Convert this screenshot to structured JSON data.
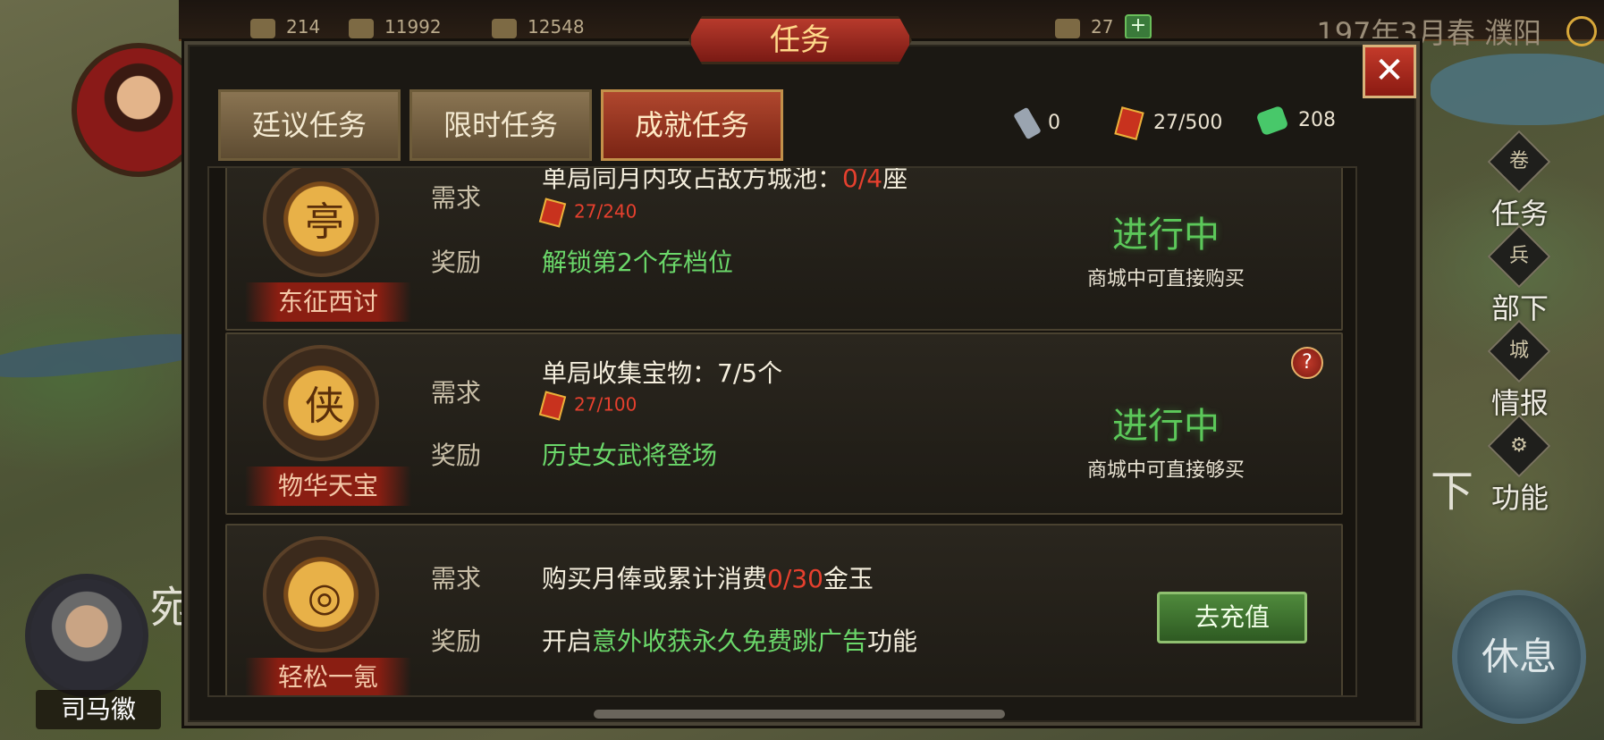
{
  "topbar": {
    "resources": [
      "214",
      "11992",
      "12548",
      "27"
    ],
    "date_location": "197年3月春 濮阳"
  },
  "left": {
    "character_name": "司马徽",
    "map_text": "宛"
  },
  "right_menu": {
    "items": [
      {
        "label": "任务",
        "icon": "scroll-icon"
      },
      {
        "label": "部下",
        "icon": "soldier-icon"
      },
      {
        "label": "情报",
        "icon": "city-gate-icon"
      },
      {
        "label": "功能",
        "icon": "gear-icon"
      }
    ],
    "rest_label": "休息",
    "map_text": "下"
  },
  "panel": {
    "title": "任务",
    "close": "✕",
    "tabs": [
      {
        "label": "廷议任务",
        "active": false
      },
      {
        "label": "限时任务",
        "active": false
      },
      {
        "label": "成就任务",
        "active": true
      }
    ],
    "resources": {
      "key_count": "0",
      "token_count": "27/500",
      "jade_count": "208"
    }
  },
  "quests": [
    {
      "name": "东征西讨",
      "req_label": "需求",
      "req_text": "单局同月内攻占敌方城池：",
      "req_progress": "0/4",
      "req_suffix": "座",
      "token_progress": "27/240",
      "reward_label": "奖励",
      "reward": "解锁第2个存档位",
      "status": "进行中",
      "status_sub": "商城中可直接购买"
    },
    {
      "name": "物华天宝",
      "req_label": "需求",
      "req_text": "单局收集宝物：7/5个",
      "token_progress": "27/100",
      "reward_label": "奖励",
      "reward": "历史女武将登场",
      "status": "进行中",
      "status_sub": "商城中可直接够买",
      "help": "?"
    },
    {
      "name": "轻松一氪",
      "req_label": "需求",
      "req_prefix": "购买月俸或累计消费",
      "req_progress": "0/30",
      "req_suffix": "金玉",
      "reward_label": "奖励",
      "reward_prefix": "开启",
      "reward_highlight": "意外收获永久免费跳广告",
      "reward_suffix": "功能",
      "button": "去充值"
    }
  ]
}
